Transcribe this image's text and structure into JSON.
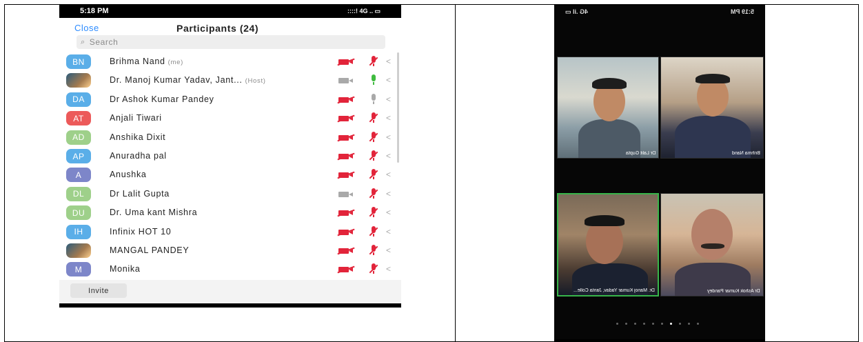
{
  "left_phone": {
    "status": {
      "time": "5:18 PM",
      "right": "::::! 4G .. ▭"
    },
    "header": {
      "close_label": "Close",
      "title": "Participants (24)"
    },
    "search": {
      "placeholder": "Search"
    },
    "invite_label": "Invite",
    "participants": [
      {
        "initials": "BN",
        "color": "#5aaee8",
        "name": "Brihma Nand",
        "tag": "(me)",
        "cam": "off",
        "mic": "muted"
      },
      {
        "initials": "",
        "color": "photo",
        "name": "Dr. Manoj Kumar Yadav, Jant...",
        "tag": "(Host)",
        "cam": "on",
        "mic": "live"
      },
      {
        "initials": "DA",
        "color": "#5aaee8",
        "name": "Dr Ashok Kumar Pandey",
        "tag": "",
        "cam": "off",
        "mic": "idle"
      },
      {
        "initials": "AT",
        "color": "#ec5a5a",
        "name": "Anjali Tiwari",
        "tag": "",
        "cam": "off",
        "mic": "muted"
      },
      {
        "initials": "AD",
        "color": "#9ed08a",
        "name": "Anshika Dixit",
        "tag": "",
        "cam": "off",
        "mic": "muted"
      },
      {
        "initials": "AP",
        "color": "#5aaee8",
        "name": "Anuradha pal",
        "tag": "",
        "cam": "off",
        "mic": "muted"
      },
      {
        "initials": "A",
        "color": "#7d86c9",
        "name": "Anushka",
        "tag": "",
        "cam": "off",
        "mic": "muted"
      },
      {
        "initials": "DL",
        "color": "#9ed08a",
        "name": "Dr Lalit Gupta",
        "tag": "",
        "cam": "on",
        "mic": "muted"
      },
      {
        "initials": "DU",
        "color": "#9ed08a",
        "name": "Dr. Uma kant Mishra",
        "tag": "",
        "cam": "off",
        "mic": "muted"
      },
      {
        "initials": "IH",
        "color": "#5aaee8",
        "name": "Infinix HOT 10",
        "tag": "",
        "cam": "off",
        "mic": "muted"
      },
      {
        "initials": "",
        "color": "photo",
        "name": "MANGAL PANDEY",
        "tag": "",
        "cam": "off",
        "mic": "muted"
      },
      {
        "initials": "M",
        "color": "#7d86c9",
        "name": "Monika",
        "tag": "",
        "cam": "off",
        "mic": "muted"
      }
    ]
  },
  "right_phone": {
    "status_left": "5:19 PM",
    "status_right": "4G .il ▭",
    "tiles": [
      {
        "label": "Dr Lalit Gupta"
      },
      {
        "label": "Brihma Nand"
      },
      {
        "label": "Dr. Manoj Kumar Yadav, Janta Colle..."
      },
      {
        "label": "Dr Ashok Kumar Pandey"
      }
    ]
  }
}
